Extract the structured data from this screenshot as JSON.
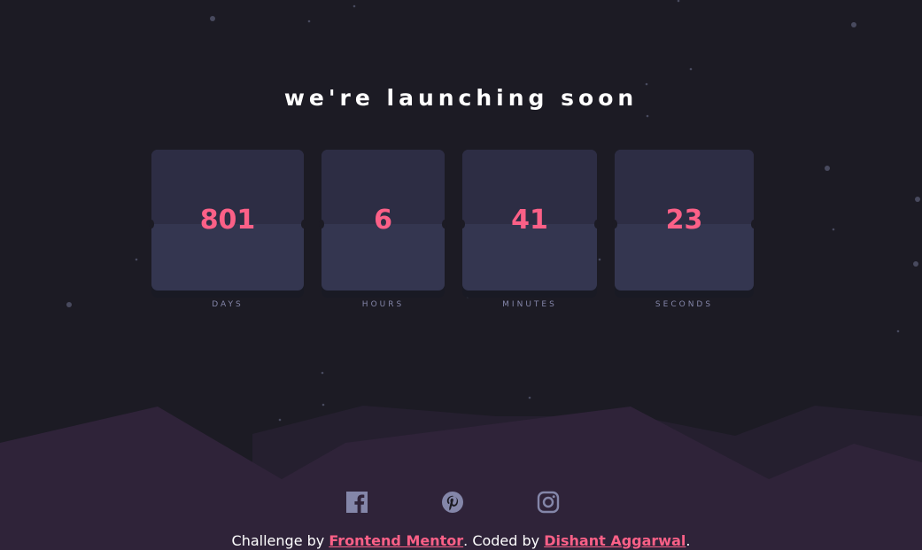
{
  "title": "we're launching soon",
  "countdown": [
    {
      "value": "801",
      "unit": "DAYS"
    },
    {
      "value": "6",
      "unit": "HOURS"
    },
    {
      "value": "41",
      "unit": "MINUTES"
    },
    {
      "value": "23",
      "unit": "SECONDS"
    }
  ],
  "social": [
    {
      "icon": "facebook-icon"
    },
    {
      "icon": "pinterest-icon"
    },
    {
      "icon": "instagram-icon"
    }
  ],
  "footer": {
    "prefix": "Challenge by ",
    "link1": "Frontend Mentor",
    "middle": ". Coded by ",
    "link2": "Dishant Aggarwal",
    "suffix": "."
  },
  "colors": {
    "background": "#1c1b24",
    "accent": "#fb6087",
    "card_bottom": "#343650",
    "card_top": "#2d2d44",
    "label": "#8486a9",
    "icon": "#8486a9",
    "hills": "#2f2339"
  }
}
